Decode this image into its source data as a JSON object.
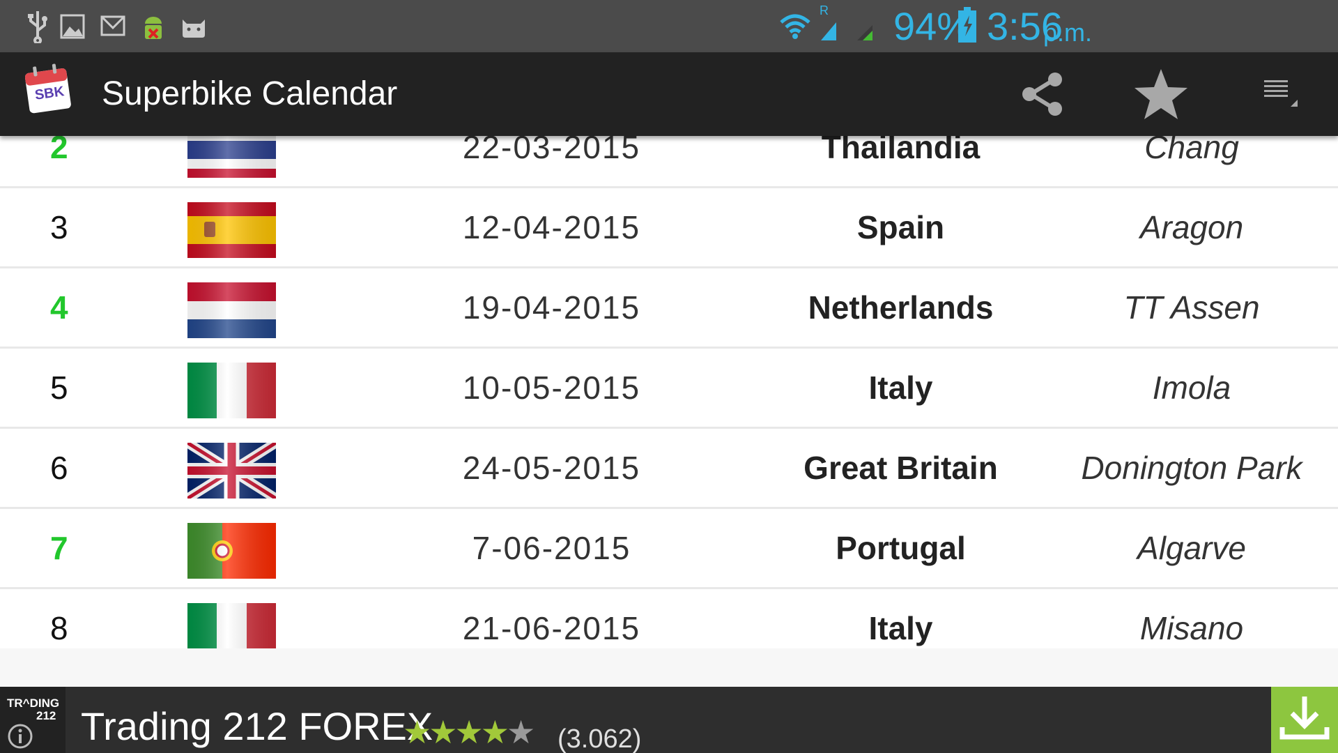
{
  "status_bar": {
    "icons": [
      "usb-icon",
      "image-icon",
      "gmail-icon",
      "android-debug-icon",
      "android-cat-icon"
    ],
    "battery_percent": "94%",
    "time": "3:56",
    "ampm": "p.m.",
    "roaming_indicator": "R",
    "accent_color": "#33b5e5"
  },
  "action_bar": {
    "app_icon_text": "SBK",
    "title": "Superbike Calendar",
    "actions": [
      "share-icon",
      "star-icon",
      "overflow-menu-icon"
    ]
  },
  "rows": [
    {
      "round": "2",
      "highlight": true,
      "flag": "thailand",
      "date": "22-03-2015",
      "country": "Thailandia",
      "circuit": "Chang"
    },
    {
      "round": "3",
      "highlight": false,
      "flag": "spain",
      "date": "12-04-2015",
      "country": "Spain",
      "circuit": "Aragon"
    },
    {
      "round": "4",
      "highlight": true,
      "flag": "netherlands",
      "date": "19-04-2015",
      "country": "Netherlands",
      "circuit": "TT Assen"
    },
    {
      "round": "5",
      "highlight": false,
      "flag": "italy",
      "date": "10-05-2015",
      "country": "Italy",
      "circuit": "Imola"
    },
    {
      "round": "6",
      "highlight": false,
      "flag": "great-britain",
      "date": "24-05-2015",
      "country": "Great Britain",
      "circuit": "Donington Park"
    },
    {
      "round": "7",
      "highlight": true,
      "flag": "portugal",
      "date": "7-06-2015",
      "country": "Portugal",
      "circuit": "Algarve"
    },
    {
      "round": "8",
      "highlight": false,
      "flag": "italy",
      "date": "21-06-2015",
      "country": "Italy",
      "circuit": "Misano"
    }
  ],
  "ad": {
    "logo_line1": "TR^DING",
    "logo_line2": "212",
    "title": "Trading 212 FOREX",
    "rating": 4,
    "rating_max": 5,
    "reviews": "(3.062)",
    "download_color": "#8dc63f"
  },
  "colors": {
    "highlight_number": "#22c72c",
    "action_bar": "#222222",
    "status_bar": "#4b4b4b"
  }
}
